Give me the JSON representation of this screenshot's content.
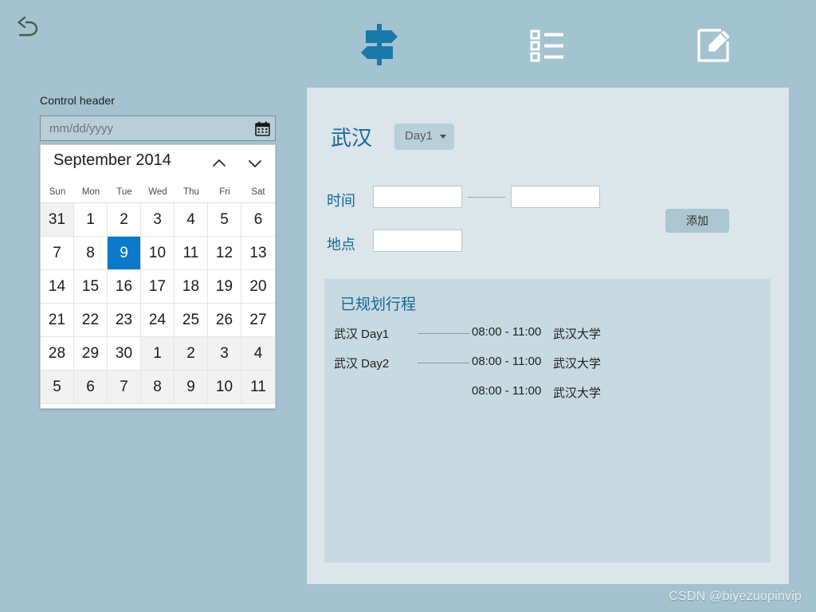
{
  "colors": {
    "app_background": "#a4c2d0",
    "toolbar_background": "#a3c3d1",
    "panel_background": "#dbe5ea",
    "itinerary_background": "#c7dae1",
    "accent_blue": "#15689b",
    "selected_day": "#0a7ac9",
    "button_background": "#aac6d2"
  },
  "left": {
    "back_icon": "back-arrow-icon",
    "control_header": "Control header",
    "date_field": {
      "value": "",
      "placeholder": "mm/dd/yyyy",
      "icon": "calendar-icon"
    },
    "calendar": {
      "month_title": "September 2014",
      "prev_icon": "chevron-up-icon",
      "next_icon": "chevron-down-icon",
      "weekdays": [
        "Sun",
        "Mon",
        "Tue",
        "Wed",
        "Thu",
        "Fri",
        "Sat"
      ],
      "days": [
        {
          "label": "31",
          "muted": true,
          "selected": false
        },
        {
          "label": "1",
          "muted": false,
          "selected": false
        },
        {
          "label": "2",
          "muted": false,
          "selected": false
        },
        {
          "label": "3",
          "muted": false,
          "selected": false
        },
        {
          "label": "4",
          "muted": false,
          "selected": false
        },
        {
          "label": "5",
          "muted": false,
          "selected": false
        },
        {
          "label": "6",
          "muted": false,
          "selected": false
        },
        {
          "label": "7",
          "muted": false,
          "selected": false
        },
        {
          "label": "8",
          "muted": false,
          "selected": false
        },
        {
          "label": "9",
          "muted": false,
          "selected": true
        },
        {
          "label": "10",
          "muted": false,
          "selected": false
        },
        {
          "label": "11",
          "muted": false,
          "selected": false
        },
        {
          "label": "12",
          "muted": false,
          "selected": false
        },
        {
          "label": "13",
          "muted": false,
          "selected": false
        },
        {
          "label": "14",
          "muted": false,
          "selected": false
        },
        {
          "label": "15",
          "muted": false,
          "selected": false
        },
        {
          "label": "16",
          "muted": false,
          "selected": false
        },
        {
          "label": "17",
          "muted": false,
          "selected": false
        },
        {
          "label": "18",
          "muted": false,
          "selected": false
        },
        {
          "label": "19",
          "muted": false,
          "selected": false
        },
        {
          "label": "20",
          "muted": false,
          "selected": false
        },
        {
          "label": "21",
          "muted": false,
          "selected": false
        },
        {
          "label": "22",
          "muted": false,
          "selected": false
        },
        {
          "label": "23",
          "muted": false,
          "selected": false
        },
        {
          "label": "24",
          "muted": false,
          "selected": false
        },
        {
          "label": "25",
          "muted": false,
          "selected": false
        },
        {
          "label": "26",
          "muted": false,
          "selected": false
        },
        {
          "label": "27",
          "muted": false,
          "selected": false
        },
        {
          "label": "28",
          "muted": false,
          "selected": false
        },
        {
          "label": "29",
          "muted": false,
          "selected": false
        },
        {
          "label": "30",
          "muted": false,
          "selected": false
        },
        {
          "label": "1",
          "muted": true,
          "selected": false
        },
        {
          "label": "2",
          "muted": true,
          "selected": false
        },
        {
          "label": "3",
          "muted": true,
          "selected": false
        },
        {
          "label": "4",
          "muted": true,
          "selected": false
        },
        {
          "label": "5",
          "muted": true,
          "selected": false
        },
        {
          "label": "6",
          "muted": true,
          "selected": false
        },
        {
          "label": "7",
          "muted": true,
          "selected": false
        },
        {
          "label": "8",
          "muted": true,
          "selected": false
        },
        {
          "label": "9",
          "muted": true,
          "selected": false
        },
        {
          "label": "10",
          "muted": true,
          "selected": false
        },
        {
          "label": "11",
          "muted": true,
          "selected": false
        }
      ]
    }
  },
  "toolbar": {
    "items": [
      {
        "icon": "signpost-directions-icon",
        "active": true
      },
      {
        "icon": "list-icon",
        "active": false
      },
      {
        "icon": "edit-note-icon",
        "active": false
      }
    ]
  },
  "main": {
    "city": "武汉",
    "day_select": {
      "value": "Day1",
      "caret": "caret-down-icon"
    },
    "form": {
      "time_label": "时间",
      "time_start": {
        "value": "",
        "placeholder": ""
      },
      "time_end": {
        "value": "",
        "placeholder": ""
      },
      "place_label": "地点",
      "place": {
        "value": "",
        "placeholder": ""
      },
      "add_button": "添加"
    },
    "itinerary": {
      "title": "已规划行程",
      "rows": [
        {
          "day": "武汉 Day1",
          "time": "08:00 - 11:00",
          "place": "武汉大学",
          "show_dash": true
        },
        {
          "day": "武汉 Day2",
          "time": "08:00 - 11:00",
          "place": "武汉大学",
          "show_dash": true
        },
        {
          "day": "",
          "time": "08:00 - 11:00",
          "place": "武汉大学",
          "show_dash": false
        }
      ]
    }
  },
  "watermark": "CSDN @biyezuopinvip"
}
